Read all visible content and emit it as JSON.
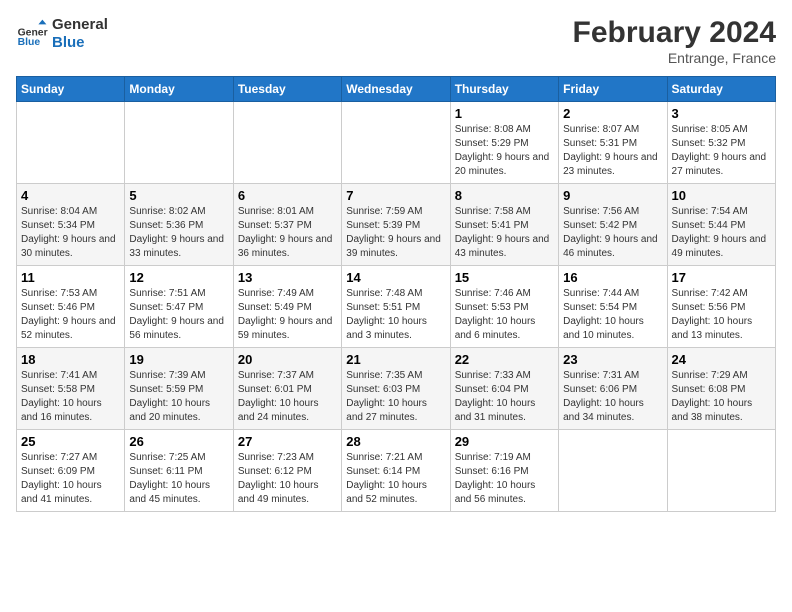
{
  "app": {
    "name1": "General",
    "name2": "Blue"
  },
  "title": "February 2024",
  "subtitle": "Entrange, France",
  "days_of_week": [
    "Sunday",
    "Monday",
    "Tuesday",
    "Wednesday",
    "Thursday",
    "Friday",
    "Saturday"
  ],
  "weeks": [
    [
      {
        "day": "",
        "info": ""
      },
      {
        "day": "",
        "info": ""
      },
      {
        "day": "",
        "info": ""
      },
      {
        "day": "",
        "info": ""
      },
      {
        "day": "1",
        "info": "Sunrise: 8:08 AM\nSunset: 5:29 PM\nDaylight: 9 hours and 20 minutes."
      },
      {
        "day": "2",
        "info": "Sunrise: 8:07 AM\nSunset: 5:31 PM\nDaylight: 9 hours and 23 minutes."
      },
      {
        "day": "3",
        "info": "Sunrise: 8:05 AM\nSunset: 5:32 PM\nDaylight: 9 hours and 27 minutes."
      }
    ],
    [
      {
        "day": "4",
        "info": "Sunrise: 8:04 AM\nSunset: 5:34 PM\nDaylight: 9 hours and 30 minutes."
      },
      {
        "day": "5",
        "info": "Sunrise: 8:02 AM\nSunset: 5:36 PM\nDaylight: 9 hours and 33 minutes."
      },
      {
        "day": "6",
        "info": "Sunrise: 8:01 AM\nSunset: 5:37 PM\nDaylight: 9 hours and 36 minutes."
      },
      {
        "day": "7",
        "info": "Sunrise: 7:59 AM\nSunset: 5:39 PM\nDaylight: 9 hours and 39 minutes."
      },
      {
        "day": "8",
        "info": "Sunrise: 7:58 AM\nSunset: 5:41 PM\nDaylight: 9 hours and 43 minutes."
      },
      {
        "day": "9",
        "info": "Sunrise: 7:56 AM\nSunset: 5:42 PM\nDaylight: 9 hours and 46 minutes."
      },
      {
        "day": "10",
        "info": "Sunrise: 7:54 AM\nSunset: 5:44 PM\nDaylight: 9 hours and 49 minutes."
      }
    ],
    [
      {
        "day": "11",
        "info": "Sunrise: 7:53 AM\nSunset: 5:46 PM\nDaylight: 9 hours and 52 minutes."
      },
      {
        "day": "12",
        "info": "Sunrise: 7:51 AM\nSunset: 5:47 PM\nDaylight: 9 hours and 56 minutes."
      },
      {
        "day": "13",
        "info": "Sunrise: 7:49 AM\nSunset: 5:49 PM\nDaylight: 9 hours and 59 minutes."
      },
      {
        "day": "14",
        "info": "Sunrise: 7:48 AM\nSunset: 5:51 PM\nDaylight: 10 hours and 3 minutes."
      },
      {
        "day": "15",
        "info": "Sunrise: 7:46 AM\nSunset: 5:53 PM\nDaylight: 10 hours and 6 minutes."
      },
      {
        "day": "16",
        "info": "Sunrise: 7:44 AM\nSunset: 5:54 PM\nDaylight: 10 hours and 10 minutes."
      },
      {
        "day": "17",
        "info": "Sunrise: 7:42 AM\nSunset: 5:56 PM\nDaylight: 10 hours and 13 minutes."
      }
    ],
    [
      {
        "day": "18",
        "info": "Sunrise: 7:41 AM\nSunset: 5:58 PM\nDaylight: 10 hours and 16 minutes."
      },
      {
        "day": "19",
        "info": "Sunrise: 7:39 AM\nSunset: 5:59 PM\nDaylight: 10 hours and 20 minutes."
      },
      {
        "day": "20",
        "info": "Sunrise: 7:37 AM\nSunset: 6:01 PM\nDaylight: 10 hours and 24 minutes."
      },
      {
        "day": "21",
        "info": "Sunrise: 7:35 AM\nSunset: 6:03 PM\nDaylight: 10 hours and 27 minutes."
      },
      {
        "day": "22",
        "info": "Sunrise: 7:33 AM\nSunset: 6:04 PM\nDaylight: 10 hours and 31 minutes."
      },
      {
        "day": "23",
        "info": "Sunrise: 7:31 AM\nSunset: 6:06 PM\nDaylight: 10 hours and 34 minutes."
      },
      {
        "day": "24",
        "info": "Sunrise: 7:29 AM\nSunset: 6:08 PM\nDaylight: 10 hours and 38 minutes."
      }
    ],
    [
      {
        "day": "25",
        "info": "Sunrise: 7:27 AM\nSunset: 6:09 PM\nDaylight: 10 hours and 41 minutes."
      },
      {
        "day": "26",
        "info": "Sunrise: 7:25 AM\nSunset: 6:11 PM\nDaylight: 10 hours and 45 minutes."
      },
      {
        "day": "27",
        "info": "Sunrise: 7:23 AM\nSunset: 6:12 PM\nDaylight: 10 hours and 49 minutes."
      },
      {
        "day": "28",
        "info": "Sunrise: 7:21 AM\nSunset: 6:14 PM\nDaylight: 10 hours and 52 minutes."
      },
      {
        "day": "29",
        "info": "Sunrise: 7:19 AM\nSunset: 6:16 PM\nDaylight: 10 hours and 56 minutes."
      },
      {
        "day": "",
        "info": ""
      },
      {
        "day": "",
        "info": ""
      }
    ]
  ]
}
